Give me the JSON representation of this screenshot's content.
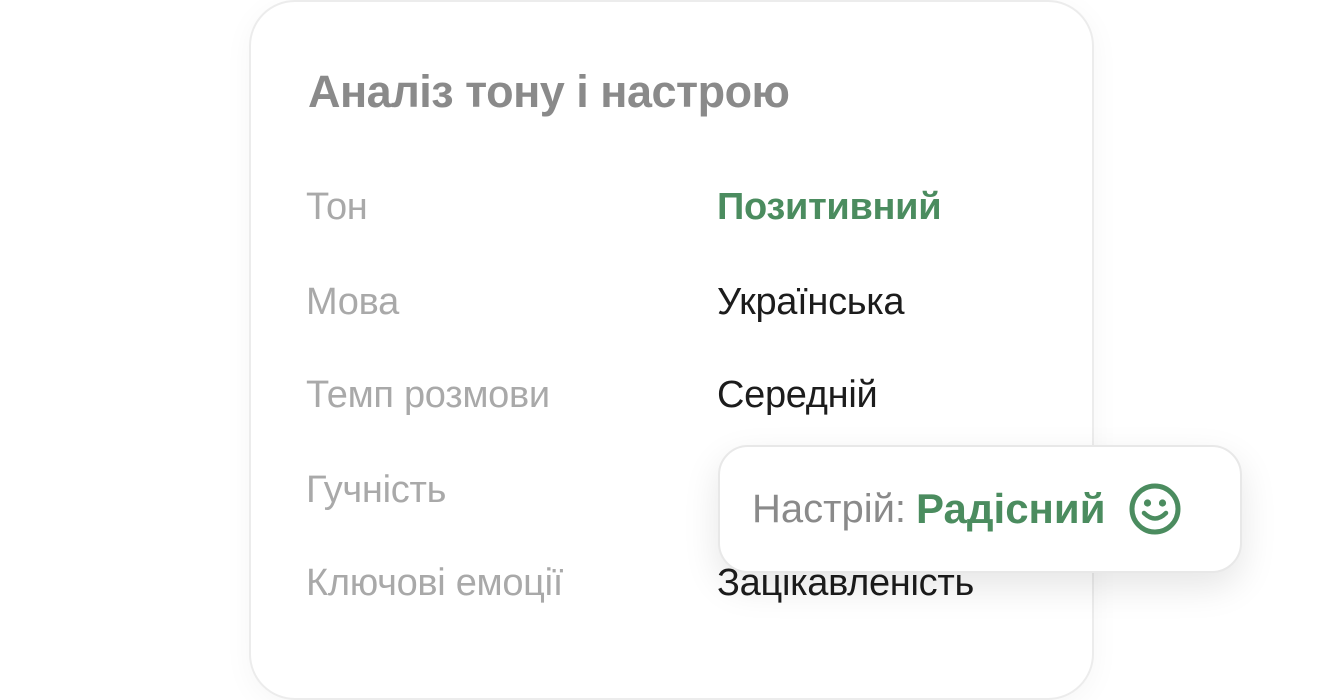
{
  "card": {
    "title": "Аналіз тону і настрою",
    "rows": [
      {
        "label": "Тон",
        "value": "Позитивний",
        "highlight": true
      },
      {
        "label": "Мова",
        "value": "Українська",
        "highlight": false
      },
      {
        "label": "Темп розмови",
        "value": "Середній",
        "highlight": false
      },
      {
        "label": "Гучність",
        "value": "",
        "highlight": false
      },
      {
        "label": "Ключові емоції",
        "value": "Зацікавленість",
        "highlight": false
      }
    ]
  },
  "mood": {
    "label": "Настрій:",
    "value": "Радісний",
    "icon": "smile-icon"
  },
  "colors": {
    "accent": "#4b8c5f",
    "label_gray": "#a9a9a9",
    "title_gray": "#8a8a8a",
    "value_dark": "#1c1c1c"
  }
}
